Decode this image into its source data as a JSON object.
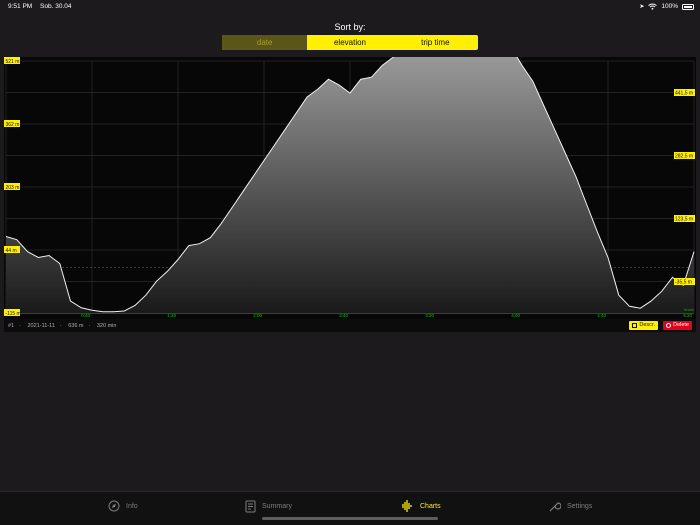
{
  "status": {
    "time": "9:51 PM",
    "date": "Sob. 30.04",
    "battery": "100%"
  },
  "sort": {
    "label": "Sort by:",
    "options": [
      "date",
      "elevation",
      "trip time"
    ],
    "selected": "date"
  },
  "chart": {
    "y_labels_left": [
      "521 m",
      "362 m",
      "203 m",
      "44 m",
      "-115 m"
    ],
    "y_labels_right": [
      "441,5 m",
      "282,5 m",
      "123,5 m",
      "-35,5 m"
    ],
    "x_labels": [
      "0:40",
      "1:20",
      "2:00",
      "2:40",
      "3:20",
      "4:00",
      "4:40",
      "5:20"
    ],
    "x_unit": "hr:min",
    "colors": {
      "accent": "#ffef00",
      "grid_x": "#16b816",
      "baseline": "#c22a2a"
    }
  },
  "chart_data": {
    "type": "area",
    "x_unit": "min",
    "x": [
      0,
      5,
      10,
      15,
      20,
      25,
      30,
      35,
      40,
      45,
      50,
      55,
      60,
      65,
      70,
      75,
      80,
      85,
      90,
      95,
      100,
      105,
      110,
      115,
      120,
      125,
      130,
      135,
      140,
      145,
      150,
      155,
      160,
      165,
      170,
      175,
      180,
      185,
      190,
      195,
      200,
      205,
      210,
      215,
      220,
      225,
      230,
      235,
      240,
      245,
      250,
      255,
      260,
      265,
      270,
      275,
      280,
      285,
      290,
      295,
      300,
      305,
      310,
      315,
      320
    ],
    "y": [
      78,
      70,
      40,
      25,
      30,
      10,
      -85,
      -102,
      -108,
      -112,
      -112,
      -110,
      -96,
      -70,
      -35,
      -10,
      20,
      55,
      60,
      75,
      110,
      150,
      190,
      230,
      270,
      310,
      350,
      390,
      430,
      450,
      475,
      460,
      440,
      475,
      480,
      510,
      530,
      550,
      590,
      610,
      650,
      680,
      700,
      697,
      660,
      630,
      595,
      555,
      510,
      470,
      410,
      350,
      290,
      230,
      160,
      90,
      25,
      -70,
      -98,
      -103,
      -85,
      -60,
      -25,
      -45,
      40
    ],
    "ylim": [
      -115,
      521
    ],
    "xlim": [
      0,
      320
    ],
    "grid": true
  },
  "record": {
    "id": "#1",
    "date": "2021-11-11",
    "elevation": "636 m",
    "duration": "320 min"
  },
  "actions": {
    "description": "Descr.",
    "delete": "Delete"
  },
  "tabs": [
    {
      "label": "Info",
      "icon": "compass-icon"
    },
    {
      "label": "Summary",
      "icon": "document-icon"
    },
    {
      "label": "Charts",
      "icon": "waveform-icon"
    },
    {
      "label": "Settings",
      "icon": "wrench-icon"
    }
  ],
  "active_tab": "Charts"
}
